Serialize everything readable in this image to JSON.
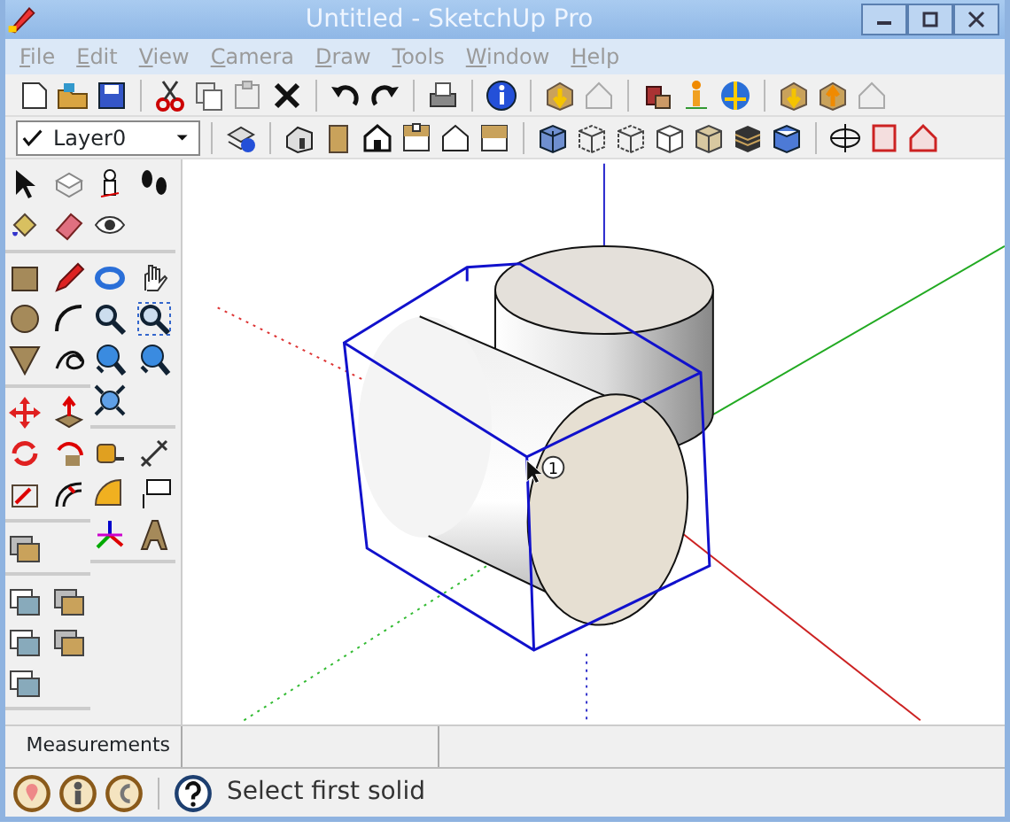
{
  "window": {
    "title": "Untitled - SketchUp Pro"
  },
  "menu": [
    {
      "label": "File",
      "disabled": true
    },
    {
      "label": "Edit",
      "disabled": true
    },
    {
      "label": "View",
      "disabled": true
    },
    {
      "label": "Camera",
      "disabled": true
    },
    {
      "label": "Draw",
      "disabled": true
    },
    {
      "label": "Tools",
      "disabled": true
    },
    {
      "label": "Window",
      "disabled": true
    },
    {
      "label": "Help",
      "disabled": true
    }
  ],
  "layer_dropdown": {
    "value": "Layer0"
  },
  "viewport": {
    "cursor_badge": "1"
  },
  "measurements": {
    "label": "Measurements"
  },
  "status_bar": {
    "message": "Select first solid"
  }
}
